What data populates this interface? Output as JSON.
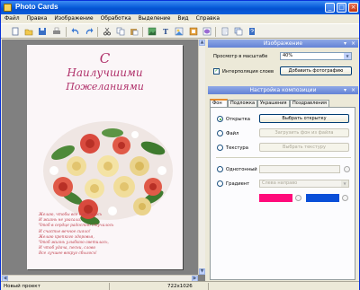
{
  "window": {
    "title": "Photo Cards",
    "minimize": "_",
    "maximize": "□",
    "close": "×"
  },
  "menu": [
    "Файл",
    "Правка",
    "Изображение",
    "Обработка",
    "Выделение",
    "Вид",
    "Справка"
  ],
  "toolbar_icons": [
    "new-icon",
    "open-icon",
    "save-icon",
    "print-icon",
    "undo-icon",
    "redo-icon",
    "cut-icon",
    "copy-icon",
    "paste-icon",
    "image-icon",
    "text-icon",
    "insert-image-icon",
    "frame-icon",
    "mask-icon",
    "document-icon",
    "layers-icon",
    "help-icon"
  ],
  "card": {
    "title_line1": "С",
    "title_line2": "Наилучшими",
    "title_line3": "Пожеланиями",
    "verse": [
      "Желаю, чтобы все сложилось",
      "И жизнь не угасала,",
      "Чтоб в сердце радостно стучалось",
      "И счастье вечное сияло!",
      "Желаю крепкого здоровья,",
      "Чтоб жизнь улыбкою светилась,",
      "И чтоб удача, песни, слово",
      "Все лучшее вокруг сбылось!"
    ]
  },
  "image_panel": {
    "header": "Изображение",
    "scale_label": "Просмотр в масштабе",
    "scale_value": "40%",
    "interp_label": "Интерполяция слоев",
    "add_photo_button": "Добавить фотографию"
  },
  "composition_panel": {
    "header": "Настройка композиции",
    "tabs": [
      "Фон",
      "Подложка",
      "Украшения",
      "Поздравления"
    ],
    "active_tab": "Фон",
    "radio_card": "Открытка",
    "select_card_button": "Выбрать открытку",
    "radio_file": "Файл",
    "load_bg_button": "Загрузить фон из файла",
    "radio_texture": "Текстура",
    "select_texture_button": "Выбрать текстуру",
    "radio_solid": "Однотонный",
    "radio_gradient": "Градиент",
    "gradient_value": "Слева направо",
    "colors": {
      "gradient_start": "#FF0A7A",
      "gradient_end": "#0A4FD8"
    }
  },
  "status": {
    "left": "Новый проект",
    "size": "722x1026"
  }
}
